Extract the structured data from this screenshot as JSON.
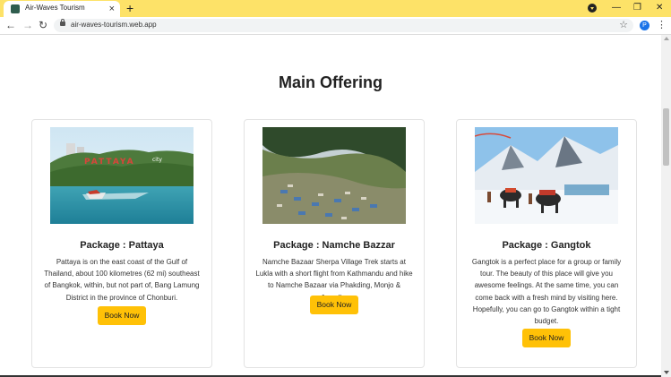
{
  "browser": {
    "tab_title": "Air-Waves Tourism",
    "tab_close": "×",
    "new_tab": "+",
    "url": "air-waves-tourism.web.app",
    "profile_initial": "P",
    "icons": {
      "back": "arrow-left",
      "forward": "arrow-right",
      "reload": "reload",
      "star": "star",
      "menu": "kebab"
    }
  },
  "main": {
    "title": "Main Offering",
    "cards": [
      {
        "heading": "Package : Pattaya",
        "description": "Pattaya is on the east coast of the Gulf of Thailand, about 100 kilometres (62 mi) southeast of Bangkok, within, but not part of, Bang Lamung District in the province of Chonburi.",
        "button": "Book Now",
        "sign_text": "PATTAYA",
        "sign_small": "city"
      },
      {
        "heading": "Package : Namche Bazzar",
        "description": "Namche Bazaar Sherpa Village Trek starts at Lukla with a short flight from Kathmandu and hike to Namche Bazaar via Phakding, Monjo & Jorsalle.",
        "button": "Book Now"
      },
      {
        "heading": "Package : Gangtok",
        "description": "Gangtok is a perfect place for a group or family tour. The beauty of this place will give you awesome feelings. At the same time, you can come back with a fresh mind by visiting here. Hopefully, you can go to Gangtok within a tight budget.",
        "button": "Book Now"
      }
    ]
  },
  "colors": {
    "accent": "#ffc107",
    "tabbar": "#fde268"
  }
}
